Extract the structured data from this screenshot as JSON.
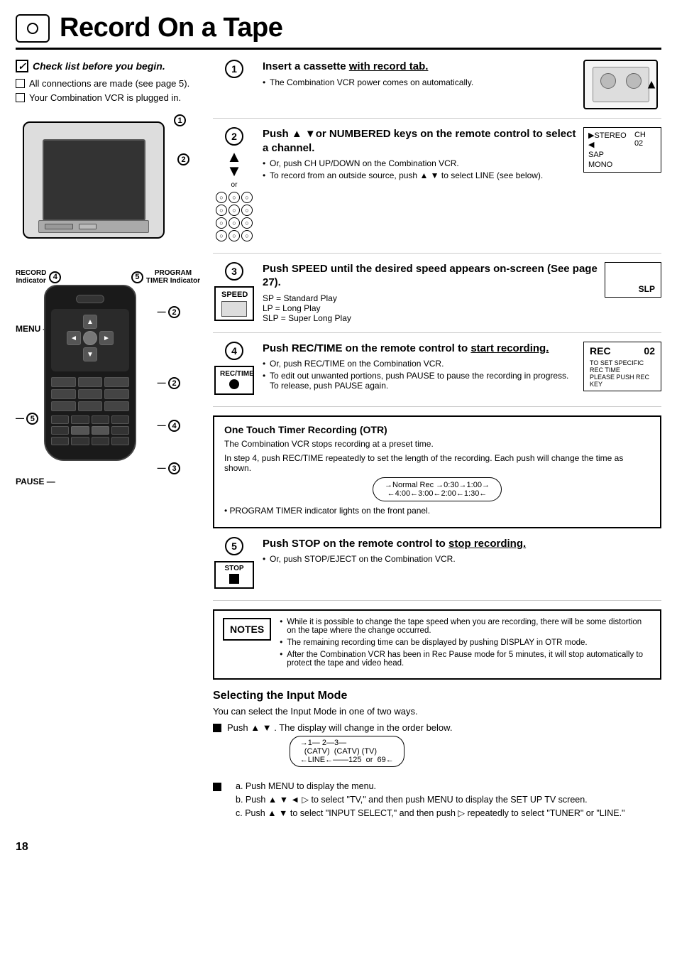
{
  "header": {
    "title": "Record On a Tape"
  },
  "checklist": {
    "title": "Check list before you begin.",
    "items": [
      "All connections are made (see page 5).",
      "Your Combination VCR is plugged in."
    ]
  },
  "tv_diagram": {
    "record_label": "RECORD",
    "indicator_label": "Indicator",
    "program_label": "PROGRAM",
    "timer_label": "TIMER Indicator",
    "ann1": "①",
    "ann2": "②"
  },
  "remote_diagram": {
    "menu_label": "MENU",
    "pause_label": "PAUSE",
    "ann2a": "②",
    "ann2b": "②",
    "ann4": "④",
    "ann3": "③",
    "ann5": "⑤"
  },
  "steps": [
    {
      "number": "1",
      "title": "Insert a cassette with record tab.",
      "bullets": [
        "The Combination VCR power comes on automatically."
      ],
      "right_box": null
    },
    {
      "number": "2",
      "title": "Push ▲ ▼or NUMBERED keys on the remote control to select a channel.",
      "bullets": [
        "Or, push CH UP/DOWN on the Combination VCR.",
        "To record from an outside source, push ▲ ▼ to select LINE (see below)."
      ],
      "right_box": {
        "type": "ch",
        "stereo": "▶STEREO ◀",
        "sap": "SAP",
        "mono": "MONO",
        "ch": "CH 02"
      }
    },
    {
      "number": "3",
      "title": "Push SPEED until the desired speed appears on-screen (See page 27).",
      "sp_text": "SP  =  Standard Play",
      "lp_text": "LP  =  Long Play",
      "slp_text": "SLP =  Super Long Play",
      "right_box": {
        "type": "slp",
        "text": "SLP"
      }
    },
    {
      "number": "4",
      "title": "Push REC/TIME on the remote control to start recording.",
      "bullets": [
        "Or, push REC/TIME on the Combination VCR.",
        "To edit out unwanted portions, push PAUSE to pause the recording in progress. To release, push PAUSE again."
      ],
      "right_box": {
        "type": "rec",
        "rec_label": "REC",
        "num": "02",
        "note": "TO SET SPECIFIC REC TIME\nPLEASE PUSH REC KEY"
      }
    }
  ],
  "otr": {
    "title": "One Touch Timer Recording (OTR)",
    "line1": "The Combination VCR stops recording at a preset time.",
    "line2": "In step 4, push REC/TIME repeatedly to set the length of the recording. Each push will change the time as shown.",
    "diagram_top": "→Normal Rec →0:30→1:00→",
    "diagram_bottom": "←4:00←3:00←2:00←1:30←",
    "note": "• PROGRAM TIMER indicator lights on the front panel."
  },
  "step5": {
    "number": "5",
    "title": "Push STOP on the remote control to stop recording.",
    "underline": "stop recording.",
    "bullet": "Or, push STOP/EJECT on the Combination VCR."
  },
  "notes": {
    "label": "NOTES",
    "items": [
      "While it is possible to change the tape speed when you are recording, there will be some distortion on the tape where the change occurred.",
      "The remaining recording time can be displayed by pushing DISPLAY in OTR mode.",
      "After the Combination VCR has been in Rec Pause mode for 5 minutes, it will stop automatically to protect the tape and video head."
    ]
  },
  "selecting": {
    "title": "Selecting the Input Mode",
    "intro": "You can select the Input Mode in one of two ways.",
    "bullet1_intro": "Push ▲ ▼ . The display will change in the order below.",
    "diagram_top": "→1— 2—3—",
    "diagram_catv1": "(CATV)",
    "diagram_catv2": "(CATV)",
    "diagram_tv": "(TV)",
    "diagram_line": "←LINE←——125  or  69←",
    "bullet2_intro": "a. Push MENU to display the menu.",
    "bullet2b": "b. Push ▲ ▼ ◄ ▷ to select \"TV,\" and then push MENU to display the SET UP TV screen.",
    "bullet2c": "c. Push ▲ ▼ to select \"INPUT SELECT,\" and then push ▷ repeatedly to select \"TUNER\" or \"LINE.\""
  },
  "page_number": "18",
  "recording_text": "recording"
}
